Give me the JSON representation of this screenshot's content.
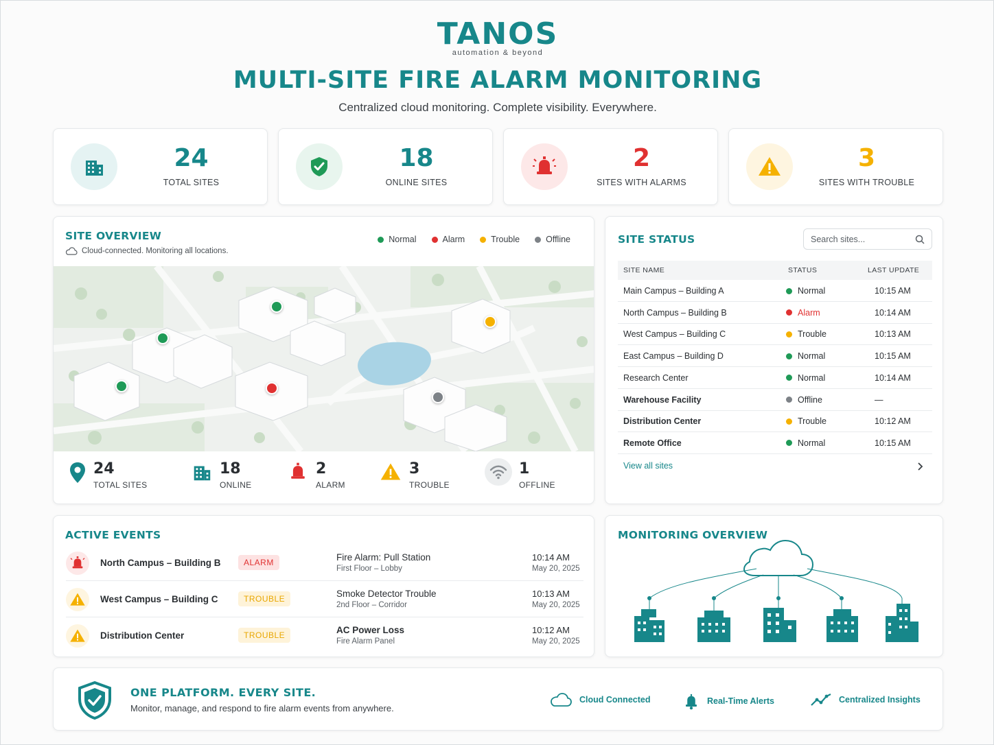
{
  "brand": {
    "logo": "TANOS",
    "tagline": "automation & beyond",
    "accent_color": "#17878a"
  },
  "header": {
    "title": "MULTI-SITE FIRE ALARM MONITORING",
    "subtitle": "Centralized cloud monitoring. Complete visibility. Everywhere."
  },
  "kpis": [
    {
      "value": "24",
      "label": "TOTAL SITES",
      "icon": "building-icon",
      "color": "#17878a"
    },
    {
      "value": "18",
      "label": "ONLINE SITES",
      "icon": "shield-check-icon",
      "color": "#17878a"
    },
    {
      "value": "2",
      "label": "SITES WITH ALARMS",
      "icon": "alarm-bell-icon",
      "color": "#e03131"
    },
    {
      "value": "3",
      "label": "SITES WITH TROUBLE",
      "icon": "warning-icon",
      "color": "#f5b100"
    }
  ],
  "site_overview": {
    "title": "SITE OVERVIEW",
    "subtitle": "Cloud-connected. Monitoring all locations.",
    "legend": [
      {
        "label": "Normal",
        "color": "#1f9a57"
      },
      {
        "label": "Alarm",
        "color": "#e03131"
      },
      {
        "label": "Trouble",
        "color": "#f5b100"
      },
      {
        "label": "Offline",
        "color": "#7d8287"
      }
    ],
    "stats": [
      {
        "value": "24",
        "label": "TOTAL SITES",
        "icon": "location-pin-icon"
      },
      {
        "value": "18",
        "label": "ONLINE",
        "icon": "building-icon"
      },
      {
        "value": "2",
        "label": "ALARM",
        "icon": "alarm-bell-icon"
      },
      {
        "value": "3",
        "label": "TROUBLE",
        "icon": "warning-icon"
      },
      {
        "value": "1",
        "label": "OFFLINE",
        "icon": "wifi-icon"
      }
    ]
  },
  "site_status": {
    "title": "SITE STATUS",
    "search_placeholder": "Search sites...",
    "columns": [
      "SITE NAME",
      "STATUS",
      "LAST UPDATE"
    ],
    "rows": [
      {
        "name": "Main Campus – Building A",
        "status": "Normal",
        "color": "#1f9a57",
        "time": "10:15 AM"
      },
      {
        "name": "North Campus – Building B",
        "status": "Alarm",
        "color": "#e03131",
        "time": "10:14 AM"
      },
      {
        "name": "West Campus – Building C",
        "status": "Trouble",
        "color": "#f5b100",
        "time": "10:13 AM"
      },
      {
        "name": "East Campus – Building D",
        "status": "Normal",
        "color": "#1f9a57",
        "time": "10:15 AM"
      },
      {
        "name": "Research Center",
        "status": "Normal",
        "color": "#1f9a57",
        "time": "10:14 AM"
      },
      {
        "name": "Warehouse Facility",
        "status": "Offline",
        "color": "#7d8287",
        "time": "—"
      },
      {
        "name": "Distribution Center",
        "status": "Trouble",
        "color": "#f5b100",
        "time": "10:12 AM"
      },
      {
        "name": "Remote Office",
        "status": "Normal",
        "color": "#1f9a57",
        "time": "10:15 AM"
      }
    ],
    "view_all": "View all sites"
  },
  "active_events": {
    "title": "ACTIVE EVENTS",
    "items": [
      {
        "site": "North Campus – Building B",
        "badge": "ALARM",
        "event": "Fire Alarm: Pull Station",
        "location": "First Floor – Lobby",
        "time": "10:14 AM",
        "date": "May 20, 2025",
        "icon": "alarm-bell-icon"
      },
      {
        "site": "West Campus – Building C",
        "badge": "TROUBLE",
        "event": "Smoke Detector Trouble",
        "location": "2nd Floor – Corridor",
        "time": "10:13 AM",
        "date": "May 20, 2025",
        "icon": "warning-icon"
      },
      {
        "site": "Distribution Center",
        "badge": "TROUBLE",
        "event": "AC Power Loss",
        "location": "Fire Alarm Panel",
        "time": "10:12 AM",
        "date": "May 20, 2025",
        "icon": "warning-icon"
      }
    ]
  },
  "monitoring_overview": {
    "title": "MONITORING OVERVIEW"
  },
  "footer": {
    "title": "ONE PLATFORM. EVERY SITE.",
    "subtitle": "Monitor, manage, and respond to fire alarm events from anywhere.",
    "features": [
      {
        "label": "Cloud Connected",
        "icon": "cloud-icon"
      },
      {
        "label": "Real-Time Alerts",
        "icon": "bell-icon"
      },
      {
        "label": "Centralized Insights",
        "icon": "trend-line-icon"
      }
    ]
  }
}
